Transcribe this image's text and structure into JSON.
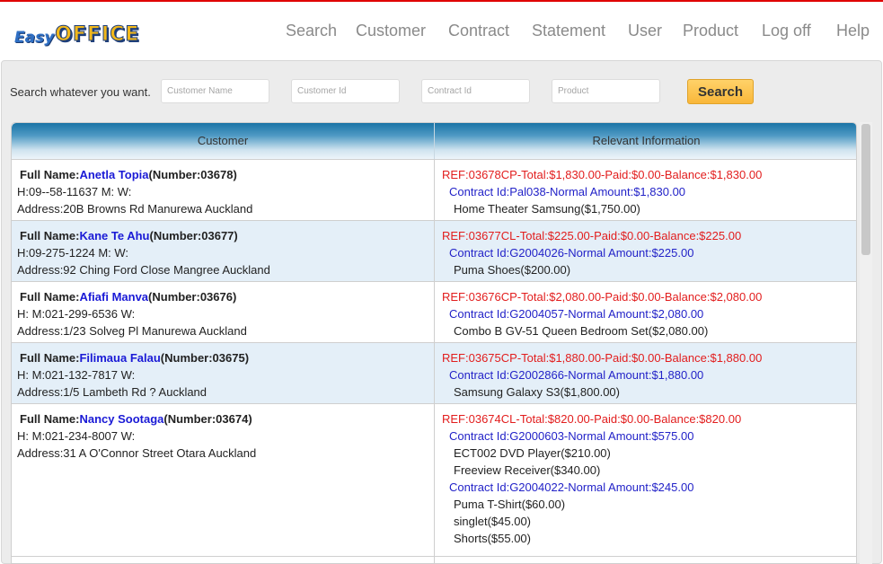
{
  "brand": {
    "part1": "Easy",
    "part2": "OFFICE"
  },
  "nav": [
    {
      "label": "Search"
    },
    {
      "label": "Customer"
    },
    {
      "label": "Contract"
    },
    {
      "label": "Statement"
    },
    {
      "label": "User"
    },
    {
      "label": "Product"
    },
    {
      "label": "Log off"
    },
    {
      "label": "Help"
    }
  ],
  "search": {
    "prompt": "Search whatever you want.",
    "customer_name_placeholder": "Customer Name",
    "customer_id_placeholder": "Customer Id",
    "contract_id_placeholder": "Contract Id",
    "product_placeholder": "Product",
    "button_label": "Search"
  },
  "table": {
    "headers": [
      "Customer",
      "Relevant Information"
    ],
    "rows": [
      {
        "name_label": "Full Name:",
        "name": "Anetla Topia",
        "number": "(Number:03678)",
        "phone": "H:09--58-11637 M: W:",
        "address": "Address:20B Browns Rd Manurewa Auckland",
        "ref": "REF:03678CP-Total:$1,830.00-Paid:$0.00-Balance:$1,830.00",
        "lines": [
          {
            "kind": "contract",
            "text": "Contract Id:Pal038-Normal Amount:$1,830.00"
          },
          {
            "kind": "item",
            "text": "Home Theater Samsung($1,750.00)"
          }
        ]
      },
      {
        "name_label": "Full Name:",
        "name": "Kane Te Ahu",
        "number": "(Number:03677)",
        "phone": "H:09-275-1224 M: W:",
        "address": "Address:92 Ching Ford Close Mangree Auckland",
        "ref": "REF:03677CL-Total:$225.00-Paid:$0.00-Balance:$225.00",
        "lines": [
          {
            "kind": "contract",
            "text": "Contract Id:G2004026-Normal Amount:$225.00"
          },
          {
            "kind": "item",
            "text": "Puma Shoes($200.00)"
          }
        ]
      },
      {
        "name_label": "Full Name:",
        "name": "Afiafi Manva",
        "number": "(Number:03676)",
        "phone": "H: M:021-299-6536 W:",
        "address": "Address:1/23 Solveg Pl Manurewa Auckland",
        "ref": "REF:03676CP-Total:$2,080.00-Paid:$0.00-Balance:$2,080.00",
        "lines": [
          {
            "kind": "contract",
            "text": "Contract Id:G2004057-Normal Amount:$2,080.00"
          },
          {
            "kind": "item",
            "text": "Combo B GV-51 Queen Bedroom Set($2,080.00)"
          }
        ]
      },
      {
        "name_label": "Full Name:",
        "name": "Filimaua Falau",
        "number": "(Number:03675)",
        "phone": "H: M:021-132-7817 W:",
        "address": "Address:1/5 Lambeth Rd ? Auckland",
        "ref": "REF:03675CP-Total:$1,880.00-Paid:$0.00-Balance:$1,880.00",
        "lines": [
          {
            "kind": "contract",
            "text": "Contract Id:G2002866-Normal Amount:$1,880.00"
          },
          {
            "kind": "item",
            "text": "Samsung Galaxy S3($1,800.00)"
          }
        ]
      },
      {
        "name_label": "Full Name:",
        "name": "Nancy Sootaga",
        "number": "(Number:03674)",
        "phone": "H: M:021-234-8007 W:",
        "address": "Address:31 A O'Connor Street Otara Auckland",
        "ref": "REF:03674CL-Total:$820.00-Paid:$0.00-Balance:$820.00",
        "lines": [
          {
            "kind": "contract",
            "text": "Contract Id:G2000603-Normal Amount:$575.00"
          },
          {
            "kind": "item",
            "text": "ECT002 DVD Player($210.00)"
          },
          {
            "kind": "item",
            "text": "Freeview Receiver($340.00)"
          },
          {
            "kind": "contract",
            "text": "Contract Id:G2004022-Normal Amount:$245.00"
          },
          {
            "kind": "item",
            "text": "Puma T-Shirt($60.00)"
          },
          {
            "kind": "item",
            "text": "singlet($45.00)"
          },
          {
            "kind": "item",
            "text": "Shorts($55.00)"
          }
        ]
      }
    ]
  }
}
